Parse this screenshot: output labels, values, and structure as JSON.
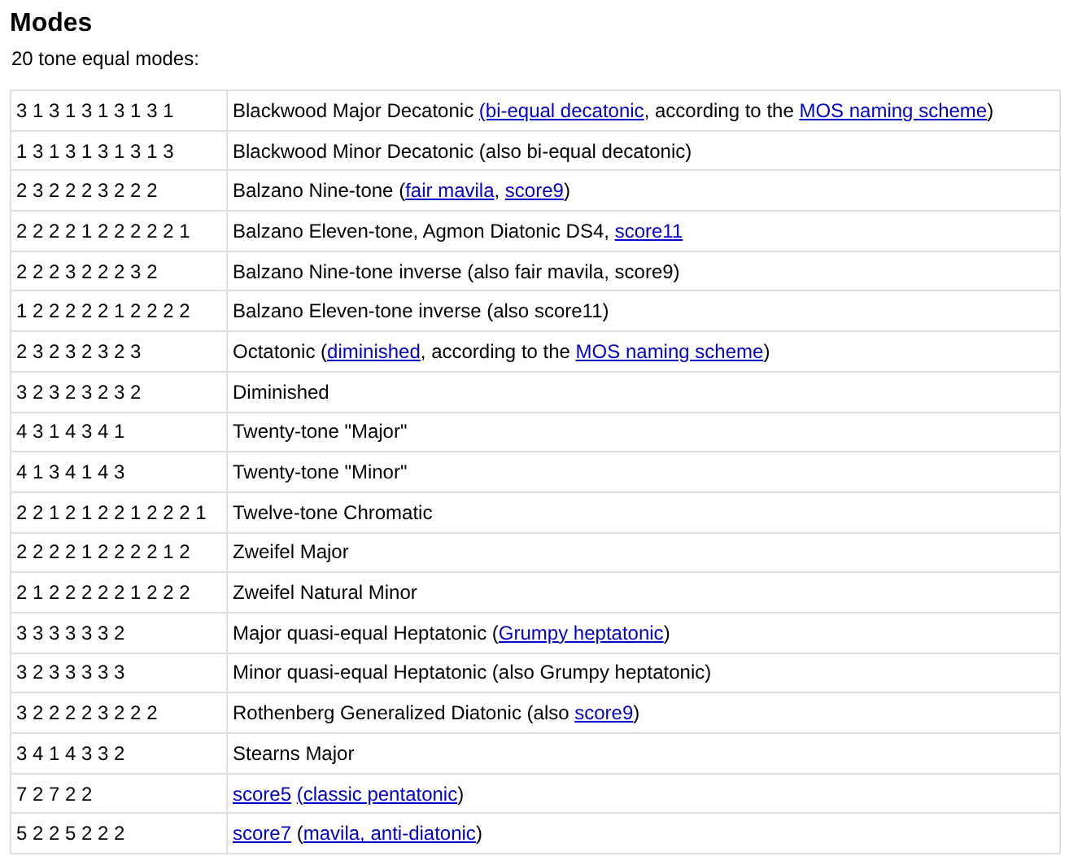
{
  "heading": "Modes",
  "intro": "20 tone equal modes:",
  "table": {
    "rows": [
      {
        "steps": "3 1 3 1 3 1 3 1 3 1",
        "description": [
          {
            "kind": "text",
            "text": "Blackwood Major Decatonic "
          },
          {
            "kind": "link",
            "text": "(bi-equal decatonic"
          },
          {
            "kind": "text",
            "text": ", according to the "
          },
          {
            "kind": "link",
            "text": "MOS naming scheme"
          },
          {
            "kind": "text",
            "text": ")"
          }
        ]
      },
      {
        "steps": "1 3 1 3 1 3 1 3 1 3",
        "description": [
          {
            "kind": "text",
            "text": "Blackwood Minor Decatonic (also bi-equal decatonic)"
          }
        ]
      },
      {
        "steps": "2 3 2 2 2 3 2 2 2",
        "description": [
          {
            "kind": "text",
            "text": "Balzano Nine-tone ("
          },
          {
            "kind": "link",
            "text": "fair mavila"
          },
          {
            "kind": "text",
            "text": ", "
          },
          {
            "kind": "link",
            "text": "score9"
          },
          {
            "kind": "text",
            "text": ")"
          }
        ]
      },
      {
        "steps": "2 2 2 2 1 2 2 2 2 2 1",
        "description": [
          {
            "kind": "text",
            "text": "Balzano Eleven-tone, Agmon Diatonic DS4, "
          },
          {
            "kind": "link",
            "text": "score11"
          }
        ]
      },
      {
        "steps": "2 2 2 3 2 2 2 3 2",
        "description": [
          {
            "kind": "text",
            "text": "Balzano Nine-tone inverse (also fair mavila, score9)"
          }
        ]
      },
      {
        "steps": "1 2 2 2 2 2 1 2 2 2 2",
        "description": [
          {
            "kind": "text",
            "text": "Balzano Eleven-tone inverse (also score11)"
          }
        ]
      },
      {
        "steps": "2 3 2 3 2 3 2 3",
        "description": [
          {
            "kind": "text",
            "text": "Octatonic ("
          },
          {
            "kind": "link",
            "text": "diminished"
          },
          {
            "kind": "text",
            "text": ", according to the "
          },
          {
            "kind": "link",
            "text": "MOS naming scheme"
          },
          {
            "kind": "text",
            "text": ")"
          }
        ]
      },
      {
        "steps": "3 2 3 2 3 2 3 2",
        "description": [
          {
            "kind": "text",
            "text": "Diminished"
          }
        ]
      },
      {
        "steps": "4 3 1 4 3 4 1",
        "description": [
          {
            "kind": "text",
            "text": "Twenty-tone \"Major\""
          }
        ]
      },
      {
        "steps": "4 1 3 4 1 4 3",
        "description": [
          {
            "kind": "text",
            "text": "Twenty-tone \"Minor\""
          }
        ]
      },
      {
        "steps": "2 2 1 2 1 2 2 1 2 2 2 1",
        "description": [
          {
            "kind": "text",
            "text": "Twelve-tone Chromatic"
          }
        ]
      },
      {
        "steps": "2 2 2 2 1 2 2 2 2 1 2",
        "description": [
          {
            "kind": "text",
            "text": "Zweifel Major"
          }
        ]
      },
      {
        "steps": "2 1 2 2 2 2 2 1 2 2 2",
        "description": [
          {
            "kind": "text",
            "text": "Zweifel Natural Minor"
          }
        ]
      },
      {
        "steps": "3 3 3 3 3 3 2",
        "description": [
          {
            "kind": "text",
            "text": "Major quasi-equal Heptatonic ("
          },
          {
            "kind": "link",
            "text": "Grumpy heptatonic"
          },
          {
            "kind": "text",
            "text": ")"
          }
        ]
      },
      {
        "steps": "3 2 3 3 3 3 3",
        "description": [
          {
            "kind": "text",
            "text": "Minor quasi-equal Heptatonic (also Grumpy heptatonic)"
          }
        ]
      },
      {
        "steps": "3 2 2 2 2 3 2 2 2",
        "description": [
          {
            "kind": "text",
            "text": "Rothenberg Generalized Diatonic (also "
          },
          {
            "kind": "link",
            "text": "score9"
          },
          {
            "kind": "text",
            "text": ")"
          }
        ]
      },
      {
        "steps": "3 4 1 4 3 3 2",
        "description": [
          {
            "kind": "text",
            "text": "Stearns Major"
          }
        ]
      },
      {
        "steps": "7 2 7 2 2",
        "description": [
          {
            "kind": "link",
            "text": "score5"
          },
          {
            "kind": "space"
          },
          {
            "kind": "link",
            "text": "(classic pentatonic"
          },
          {
            "kind": "text",
            "text": ")"
          }
        ]
      },
      {
        "steps": "5 2 2 5 2 2 2",
        "description": [
          {
            "kind": "link",
            "text": "score7"
          },
          {
            "kind": "text",
            "text": " ("
          },
          {
            "kind": "link",
            "text": "mavila, anti-diatonic"
          },
          {
            "kind": "text",
            "text": ")"
          }
        ]
      }
    ]
  }
}
